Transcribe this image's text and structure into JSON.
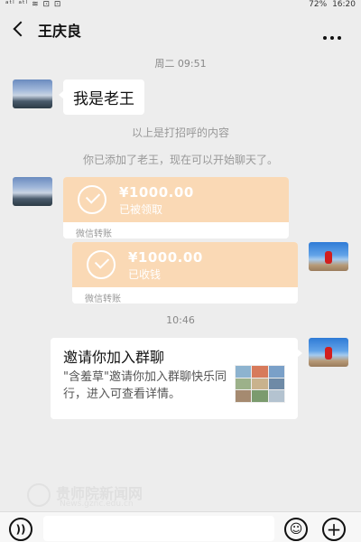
{
  "status_bar": {
    "left": "ᵃᵗˡ ᵃᵗˡ ≋ ⊡ ⊡",
    "battery": "72%",
    "time": "16:20"
  },
  "header": {
    "title": "王庆良"
  },
  "messages": {
    "time1": "周二 09:51",
    "hello": "我是老王",
    "sys1": "以上是打招呼的内容",
    "sys2": "你已添加了老王，现在可以开始聊天了。",
    "transfer1": {
      "amount": "¥1000.00",
      "status": "已被领取",
      "label": "微信转账"
    },
    "transfer2": {
      "amount": "¥1000.00",
      "status": "已收钱",
      "label": "微信转账"
    },
    "time2": "10:46",
    "invite": {
      "title": "邀请你加入群聊",
      "desc": "\"含羞草\"邀请你加入群聊快乐同行，进入可查看详情。"
    }
  },
  "watermark": {
    "main": "贵师院新闻网",
    "sub": "News.gznc.edu.cn"
  },
  "bottom_bar": {
    "input_placeholder": ""
  },
  "icons": [
    "back-icon",
    "more-icon",
    "check-icon",
    "voice-icon",
    "emoji-icon",
    "plus-icon"
  ]
}
